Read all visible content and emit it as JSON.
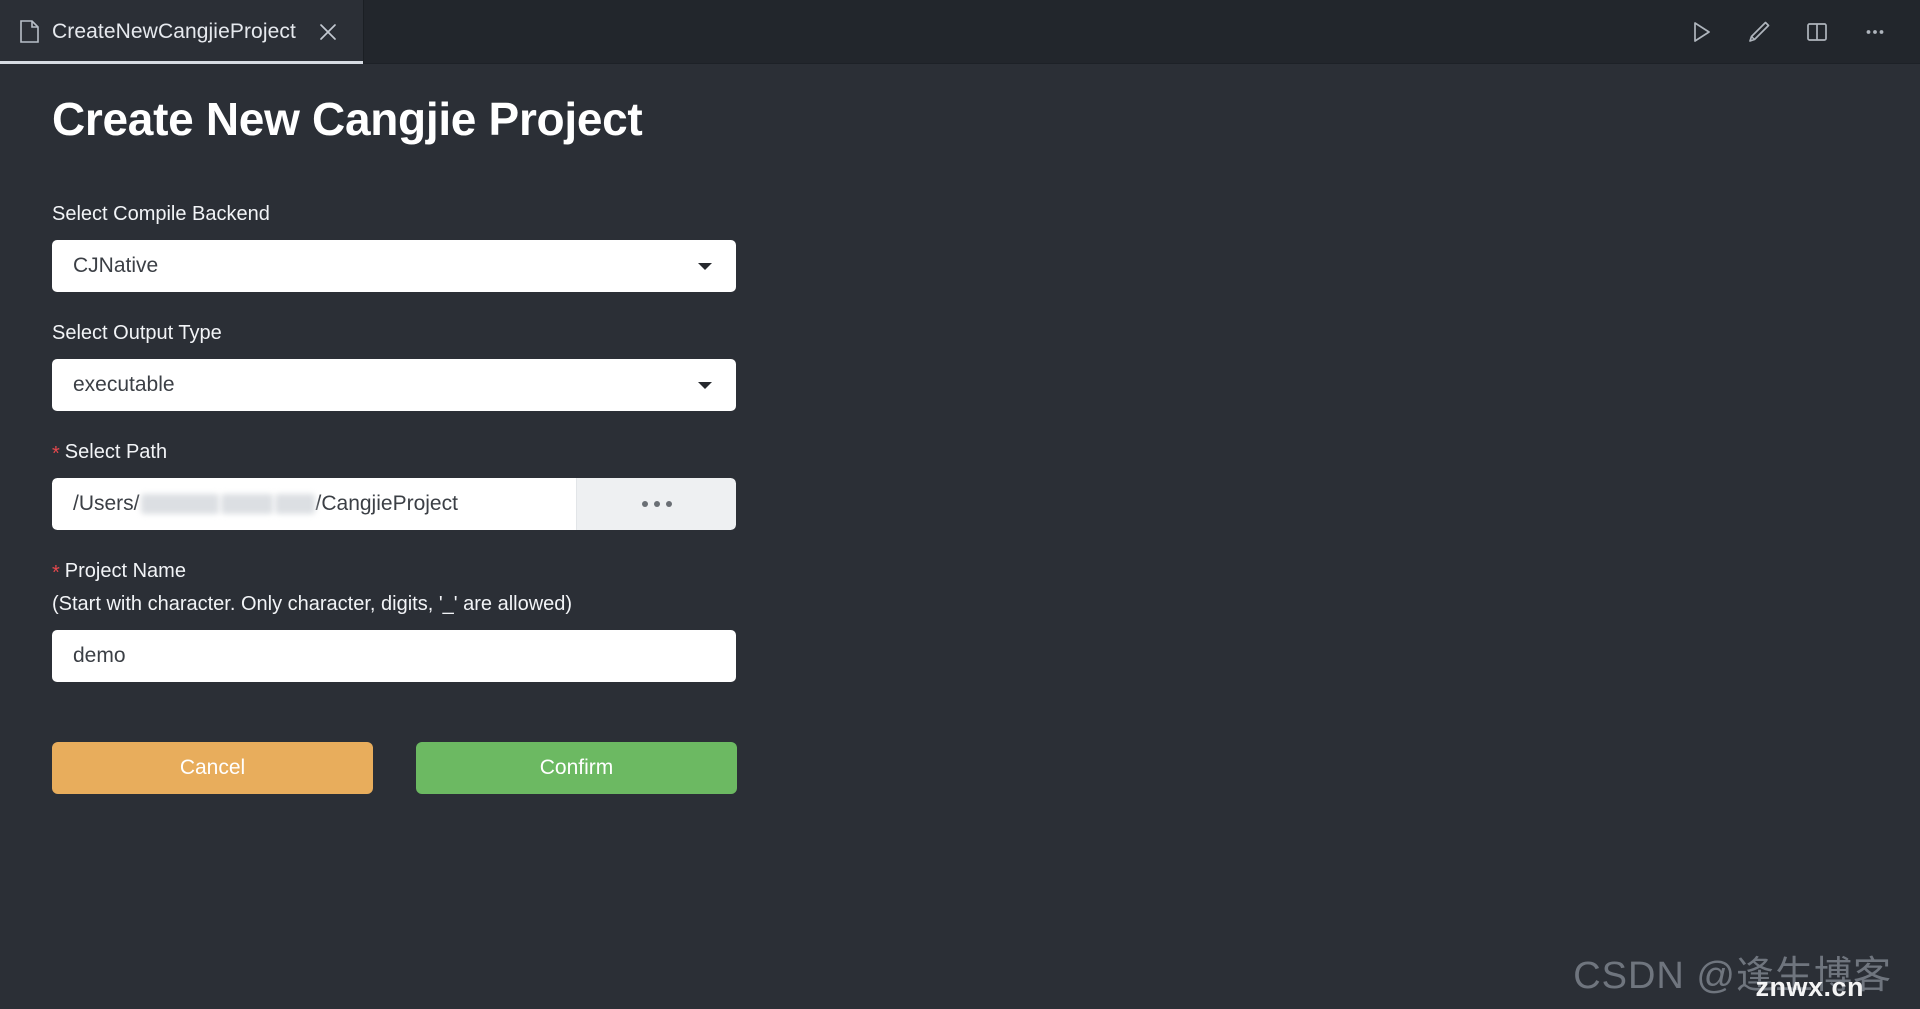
{
  "window": {
    "tab": {
      "label": "CreateNewCangjieProject",
      "file_icon": "file-icon",
      "close_icon": "close-icon"
    },
    "actions": [
      {
        "name": "run-button",
        "icon": "play-icon"
      },
      {
        "name": "edit-button",
        "icon": "pencil-icon"
      },
      {
        "name": "split-view-button",
        "icon": "split-panel-icon"
      },
      {
        "name": "more-button",
        "icon": "ellipsis-icon"
      }
    ]
  },
  "page": {
    "title": "Create New Cangjie Project"
  },
  "form": {
    "compile_backend": {
      "label": "Select Compile Backend",
      "value": "CJNative",
      "chevron_icon": "chevron-down-icon"
    },
    "output_type": {
      "label": "Select Output Type",
      "value": "executable",
      "chevron_icon": "chevron-down-icon"
    },
    "select_path": {
      "required_marker": "*",
      "label": "Select Path",
      "value_prefix": "/Users/",
      "value_suffix": "/CangjieProject",
      "redacted": true,
      "browse_label": "...",
      "browse_icon": "ellipsis-icon"
    },
    "project_name": {
      "required_marker": "*",
      "label": "Project Name",
      "hint": "(Start with character. Only character, digits, '_' are allowed)",
      "value": "demo"
    }
  },
  "buttons": {
    "cancel": {
      "label": "Cancel",
      "color": "#e8ad5c"
    },
    "confirm": {
      "label": "Confirm",
      "color": "#6cb962"
    }
  },
  "watermark": {
    "text": "CSDN @逢生博客",
    "sub": "znwx.cn"
  },
  "colors": {
    "background": "#2b2f36",
    "tabbar": "#22262c",
    "field_bg": "#ffffff",
    "required": "#e5484d",
    "accent_cancel": "#e8ad5c",
    "accent_confirm": "#6cb962"
  }
}
